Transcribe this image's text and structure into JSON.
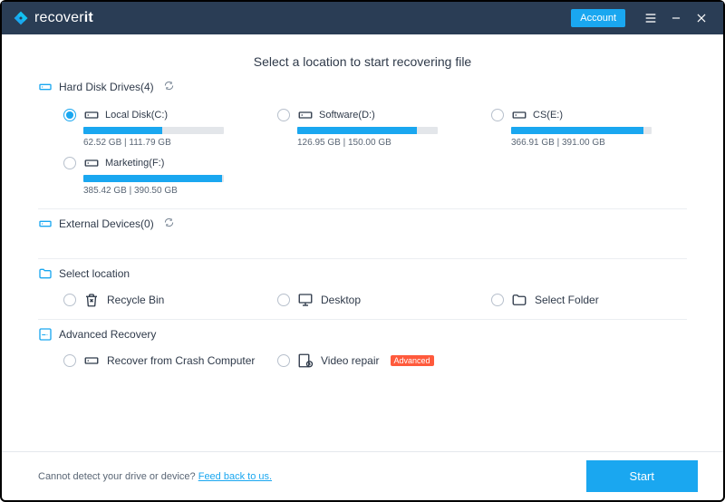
{
  "brand": {
    "name_pre": "recover",
    "name_post": "it"
  },
  "titlebar": {
    "account": "Account"
  },
  "page_title": "Select a location to start recovering file",
  "sections": {
    "drives": {
      "label": "Hard Disk Drives(4)"
    },
    "external": {
      "label": "External Devices(0)"
    },
    "select_loc": {
      "label": "Select location"
    },
    "advanced": {
      "label": "Advanced Recovery"
    }
  },
  "drives": [
    {
      "name": "Local Disk(C:)",
      "size": "62.52  GB | 111.79  GB",
      "used_pct": 56,
      "selected": true
    },
    {
      "name": "Software(D:)",
      "size": "126.95  GB | 150.00  GB",
      "used_pct": 85,
      "selected": false
    },
    {
      "name": "CS(E:)",
      "size": "366.91  GB | 391.00  GB",
      "used_pct": 94,
      "selected": false
    },
    {
      "name": "Marketing(F:)",
      "size": "385.42  GB | 390.50  GB",
      "used_pct": 99,
      "selected": false
    }
  ],
  "locations": [
    {
      "name": "Recycle Bin",
      "icon": "recycle-bin-icon"
    },
    {
      "name": "Desktop",
      "icon": "desktop-icon"
    },
    {
      "name": "Select Folder",
      "icon": "folder-icon"
    }
  ],
  "advanced": [
    {
      "name": "Recover from Crash Computer",
      "icon": "drive-icon",
      "badge": ""
    },
    {
      "name": "Video repair",
      "icon": "video-repair-icon",
      "badge": "Advanced"
    }
  ],
  "footer": {
    "text": "Cannot detect your drive or device? ",
    "link": "Feed back to us.",
    "start": "Start"
  }
}
